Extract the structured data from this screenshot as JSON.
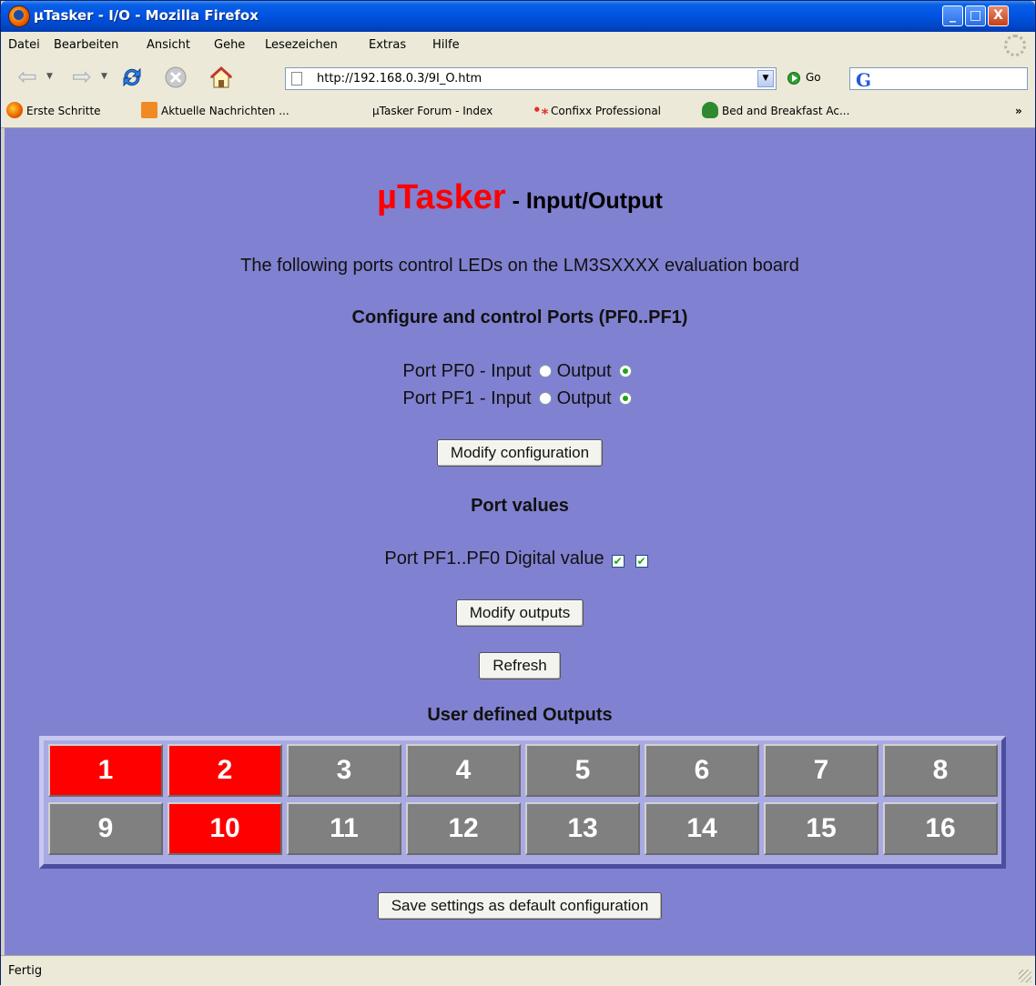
{
  "window": {
    "title": "µTasker - I/O - Mozilla Firefox",
    "controls": {
      "minimize": "_",
      "maximize": "□",
      "close": "X"
    }
  },
  "menu": [
    "Datei",
    "Bearbeiten",
    "Ansicht",
    "Gehe",
    "Lesezeichen",
    "Extras",
    "Hilfe"
  ],
  "toolbar": {
    "url": "http://192.168.0.3/9I_O.htm",
    "go_label": "Go",
    "search_engine_icon": "G"
  },
  "bookmarks": [
    {
      "label": "Erste Schritte",
      "icon": "firefox-icon"
    },
    {
      "label": "Aktuelle Nachrichten ...",
      "icon": "rss-icon"
    },
    {
      "label": "µTasker Forum - Index",
      "icon": ""
    },
    {
      "label": "Confixx Professional",
      "icon": "confixx-icon"
    },
    {
      "label": "Bed and Breakfast Ac...",
      "icon": "frog-icon"
    },
    {
      "label": "»",
      "icon": ""
    }
  ],
  "page": {
    "logo": "µTasker",
    "title": " - Input/Output",
    "intro": "The following ports control LEDs on the LM3SXXXX evaluation board",
    "config_heading": "Configure and control Ports (PF0..PF1)",
    "ports": [
      {
        "label": "Port PF0 - Input",
        "output_label": "Output",
        "selected": "output"
      },
      {
        "label": "Port PF1 - Input",
        "output_label": "Output",
        "selected": "output"
      }
    ],
    "modify_config_label": "Modify configuration",
    "values_heading": "Port values",
    "digital_value_label": "Port PF1..PF0 Digital value",
    "digital_values": [
      true,
      true
    ],
    "modify_outputs_label": "Modify outputs",
    "refresh_label": "Refresh",
    "outputs_heading": "User defined Outputs",
    "outputs": [
      {
        "n": "1",
        "on": true
      },
      {
        "n": "2",
        "on": true
      },
      {
        "n": "3",
        "on": false
      },
      {
        "n": "4",
        "on": false
      },
      {
        "n": "5",
        "on": false
      },
      {
        "n": "6",
        "on": false
      },
      {
        "n": "7",
        "on": false
      },
      {
        "n": "8",
        "on": false
      },
      {
        "n": "9",
        "on": false
      },
      {
        "n": "10",
        "on": true
      },
      {
        "n": "11",
        "on": false
      },
      {
        "n": "12",
        "on": false
      },
      {
        "n": "13",
        "on": false
      },
      {
        "n": "14",
        "on": false
      },
      {
        "n": "15",
        "on": false
      },
      {
        "n": "16",
        "on": false
      }
    ],
    "save_label": "Save settings as default configuration"
  },
  "status": {
    "text": "Fertig"
  },
  "colors": {
    "page_background": "#8181d1",
    "output_on": "#ff0000",
    "output_off": "#808080",
    "logo": "#ff0000"
  }
}
